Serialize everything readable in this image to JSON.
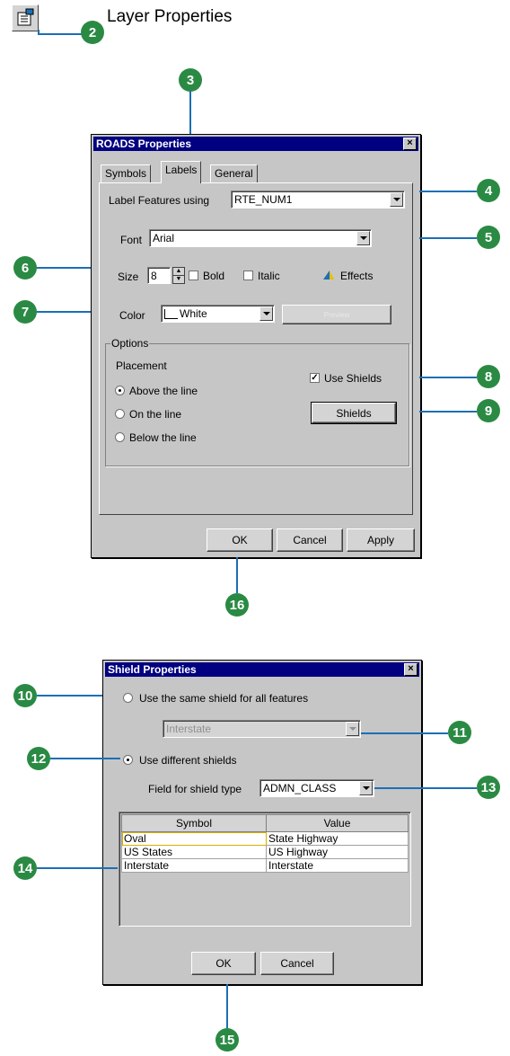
{
  "header": {
    "title": "Layer Properties",
    "icon": "layer-properties-icon"
  },
  "callouts": [
    "2",
    "3",
    "4",
    "5",
    "6",
    "7",
    "8",
    "9",
    "10",
    "11",
    "12",
    "13",
    "14",
    "15",
    "16"
  ],
  "roads_dialog": {
    "title": "ROADS Properties",
    "close": "×",
    "tabs": [
      "Symbols",
      "Labels",
      "General"
    ],
    "label_features_label": "Label Features using",
    "label_features_value": "RTE_NUM1",
    "font_label": "Font",
    "font_value": "Arial",
    "size_label": "Size",
    "size_value": "8",
    "bold_label": "Bold",
    "italic_label": "Italic",
    "effects_label": "Effects",
    "color_label": "Color",
    "color_value": "White",
    "preview_label": "Preview",
    "options_label": "Options",
    "placement_label": "Placement",
    "radio_above": "Above the line",
    "radio_on": "On the line",
    "radio_below": "Below the line",
    "use_shields_label": "Use Shields",
    "shields_button": "Shields",
    "ok": "OK",
    "cancel": "Cancel",
    "apply": "Apply"
  },
  "shield_dialog": {
    "title": "Shield Properties",
    "close": "×",
    "radio_same": "Use the same shield for all features",
    "same_value": "Interstate",
    "radio_different": "Use different shields",
    "field_label": "Field for shield type",
    "field_value": "ADMN_CLASS",
    "col_symbol": "Symbol",
    "col_value": "Value",
    "rows": [
      {
        "symbol": "Oval",
        "value": "State Highway"
      },
      {
        "symbol": "US States",
        "value": "US Highway"
      },
      {
        "symbol": "Interstate",
        "value": "Interstate"
      }
    ],
    "ok": "OK",
    "cancel": "Cancel"
  },
  "colors": {
    "callout": "#2a8a43",
    "leader": "#1b6fb5",
    "titlebar": "#000080",
    "dialog": "#c6c6c6"
  }
}
